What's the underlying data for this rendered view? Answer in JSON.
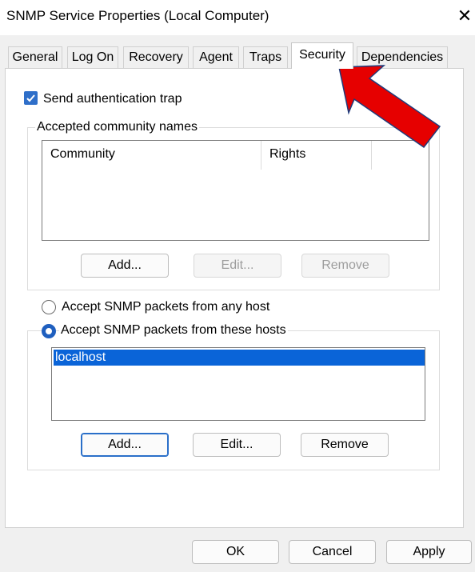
{
  "window": {
    "title": "SNMP Service Properties (Local Computer)",
    "close_glyph": "✕"
  },
  "tabs": [
    {
      "label": "General"
    },
    {
      "label": "Log On"
    },
    {
      "label": "Recovery"
    },
    {
      "label": "Agent"
    },
    {
      "label": "Traps"
    },
    {
      "label": "Security",
      "active": true
    },
    {
      "label": "Dependencies"
    }
  ],
  "security": {
    "send_auth_trap_label": "Send authentication trap",
    "send_auth_trap_checked": true,
    "community_group_label": "Accepted community names",
    "community_columns": [
      "Community",
      "Rights"
    ],
    "community_rows": [],
    "community_buttons": {
      "add": "Add...",
      "edit": "Edit...",
      "remove": "Remove"
    },
    "radio_any_host_label": "Accept SNMP packets from any host",
    "radio_these_hosts_label": "Accept SNMP packets from these hosts",
    "selected_radio": "these_hosts",
    "hosts": [
      "localhost"
    ],
    "host_buttons": {
      "add": "Add...",
      "edit": "Edit...",
      "remove": "Remove"
    }
  },
  "footer": {
    "ok": "OK",
    "cancel": "Cancel",
    "apply": "Apply"
  },
  "annotation": {
    "arrow_color": "#e60000"
  }
}
